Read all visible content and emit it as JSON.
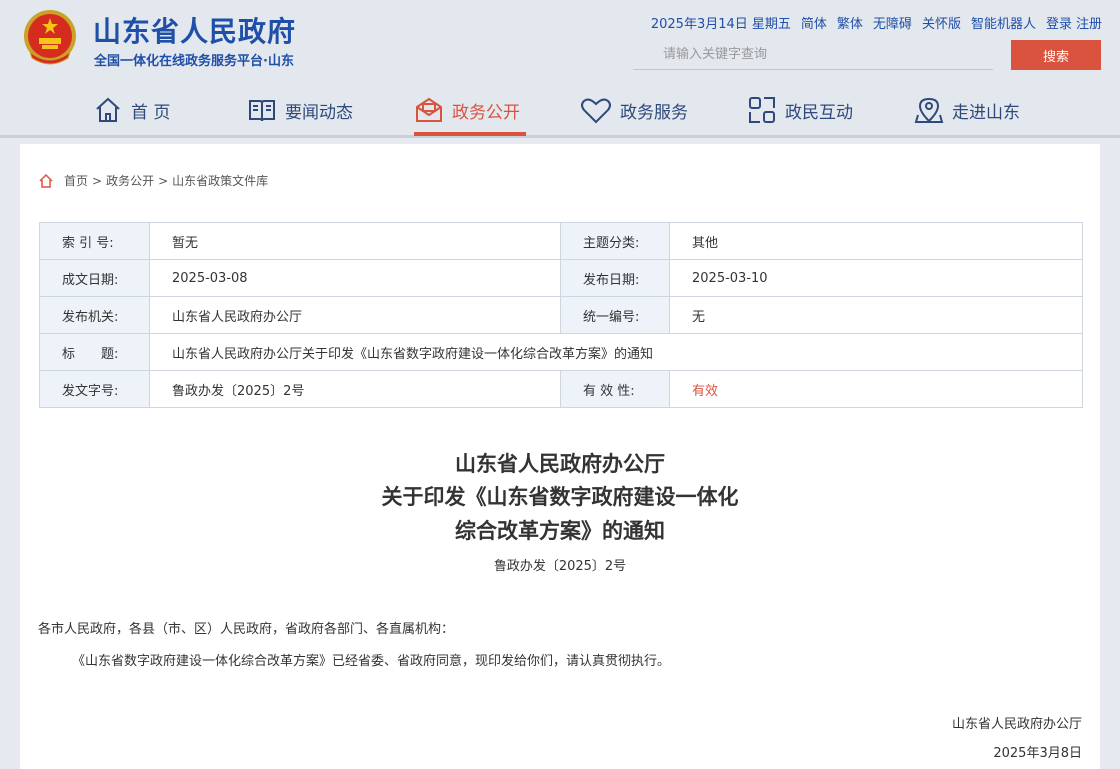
{
  "header": {
    "site_title": "山东省人民政府",
    "site_subtitle": "全国一体化在线政务服务平台·山东",
    "date": "2025年3月14日 星期五",
    "links": [
      "简体",
      "繁体",
      "无障碍",
      "关怀版",
      "智能机器人",
      "登录",
      "注册"
    ],
    "search_placeholder": "请输入关键字查询",
    "search_button": "搜索",
    "accent_color": "#d9533f",
    "brand_color": "#1f4fa8"
  },
  "nav": {
    "items": [
      {
        "label": "首 页",
        "icon": "home-icon"
      },
      {
        "label": "要闻动态",
        "icon": "book-icon"
      },
      {
        "label": "政务公开",
        "icon": "mail-icon",
        "active": true
      },
      {
        "label": "政务服务",
        "icon": "heart-icon"
      },
      {
        "label": "政民互动",
        "icon": "interaction-icon"
      },
      {
        "label": "走进山东",
        "icon": "location-icon"
      }
    ]
  },
  "breadcrumb": [
    "首页",
    "政务公开",
    "山东省政策文件库"
  ],
  "info_table": {
    "rows": [
      {
        "label1": "索 引 号:",
        "value1": "暂无",
        "label2": "主题分类:",
        "value2": "其他"
      },
      {
        "label1": "成文日期:",
        "value1": "2025-03-08",
        "label2": "发布日期:",
        "value2": "2025-03-10"
      },
      {
        "label1": "发布机关:",
        "value1": "山东省人民政府办公厅",
        "label2": "统一编号:",
        "value2": "无"
      },
      {
        "label1": "标　　题:",
        "value1": "山东省人民政府办公厅关于印发《山东省数字政府建设一体化综合改革方案》的通知"
      },
      {
        "label1": "发文字号:",
        "value1": "鲁政办发〔2025〕2号",
        "label2": "有 效 性:",
        "value2": "有效"
      }
    ]
  },
  "document": {
    "title_lines": [
      "山东省人民政府办公厅",
      "关于印发《山东省数字政府建设一体化",
      "综合改革方案》的通知"
    ],
    "number": "鲁政办发〔2025〕2号",
    "salutation": "各市人民政府，各县（市、区）人民政府，省政府各部门、各直属机构：",
    "body": "《山东省数字政府建设一体化综合改革方案》已经省委、省政府同意，现印发给你们，请认真贯彻执行。",
    "signature": "山东省人民政府办公厅",
    "sign_date": "2025年3月8日"
  }
}
